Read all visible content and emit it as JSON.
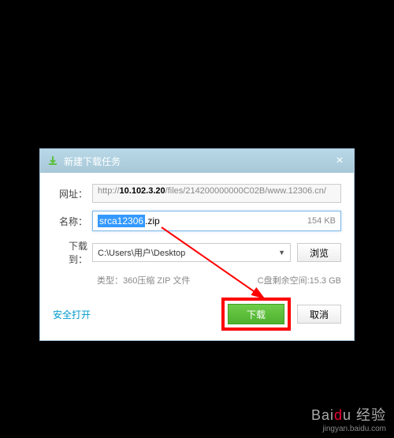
{
  "dialog": {
    "title": "新建下载任务",
    "url_label": "网址：",
    "url_prefix": "http://",
    "url_host": "10.102.3.20",
    "url_path": "/files/214200000000C02B/www.12306.cn/",
    "name_label": "名称：",
    "name_selected": "srca12306",
    "name_ext": ".zip",
    "file_size": "154 KB",
    "path_label": "下载到：",
    "path_value": "C:\\Users\\用户\\Desktop",
    "browse": "浏览",
    "file_type": "类型：360压缩 ZIP 文件",
    "disk_space": "C盘剩余空间:15.3 GB",
    "safe_open": "安全打开",
    "download": "下载",
    "cancel": "取消"
  },
  "watermark": {
    "brand_pre": "Bai",
    "brand_accent": "d",
    "brand_post": "u",
    "brand_cn": "经验",
    "url": "jingyan.baidu.com"
  }
}
